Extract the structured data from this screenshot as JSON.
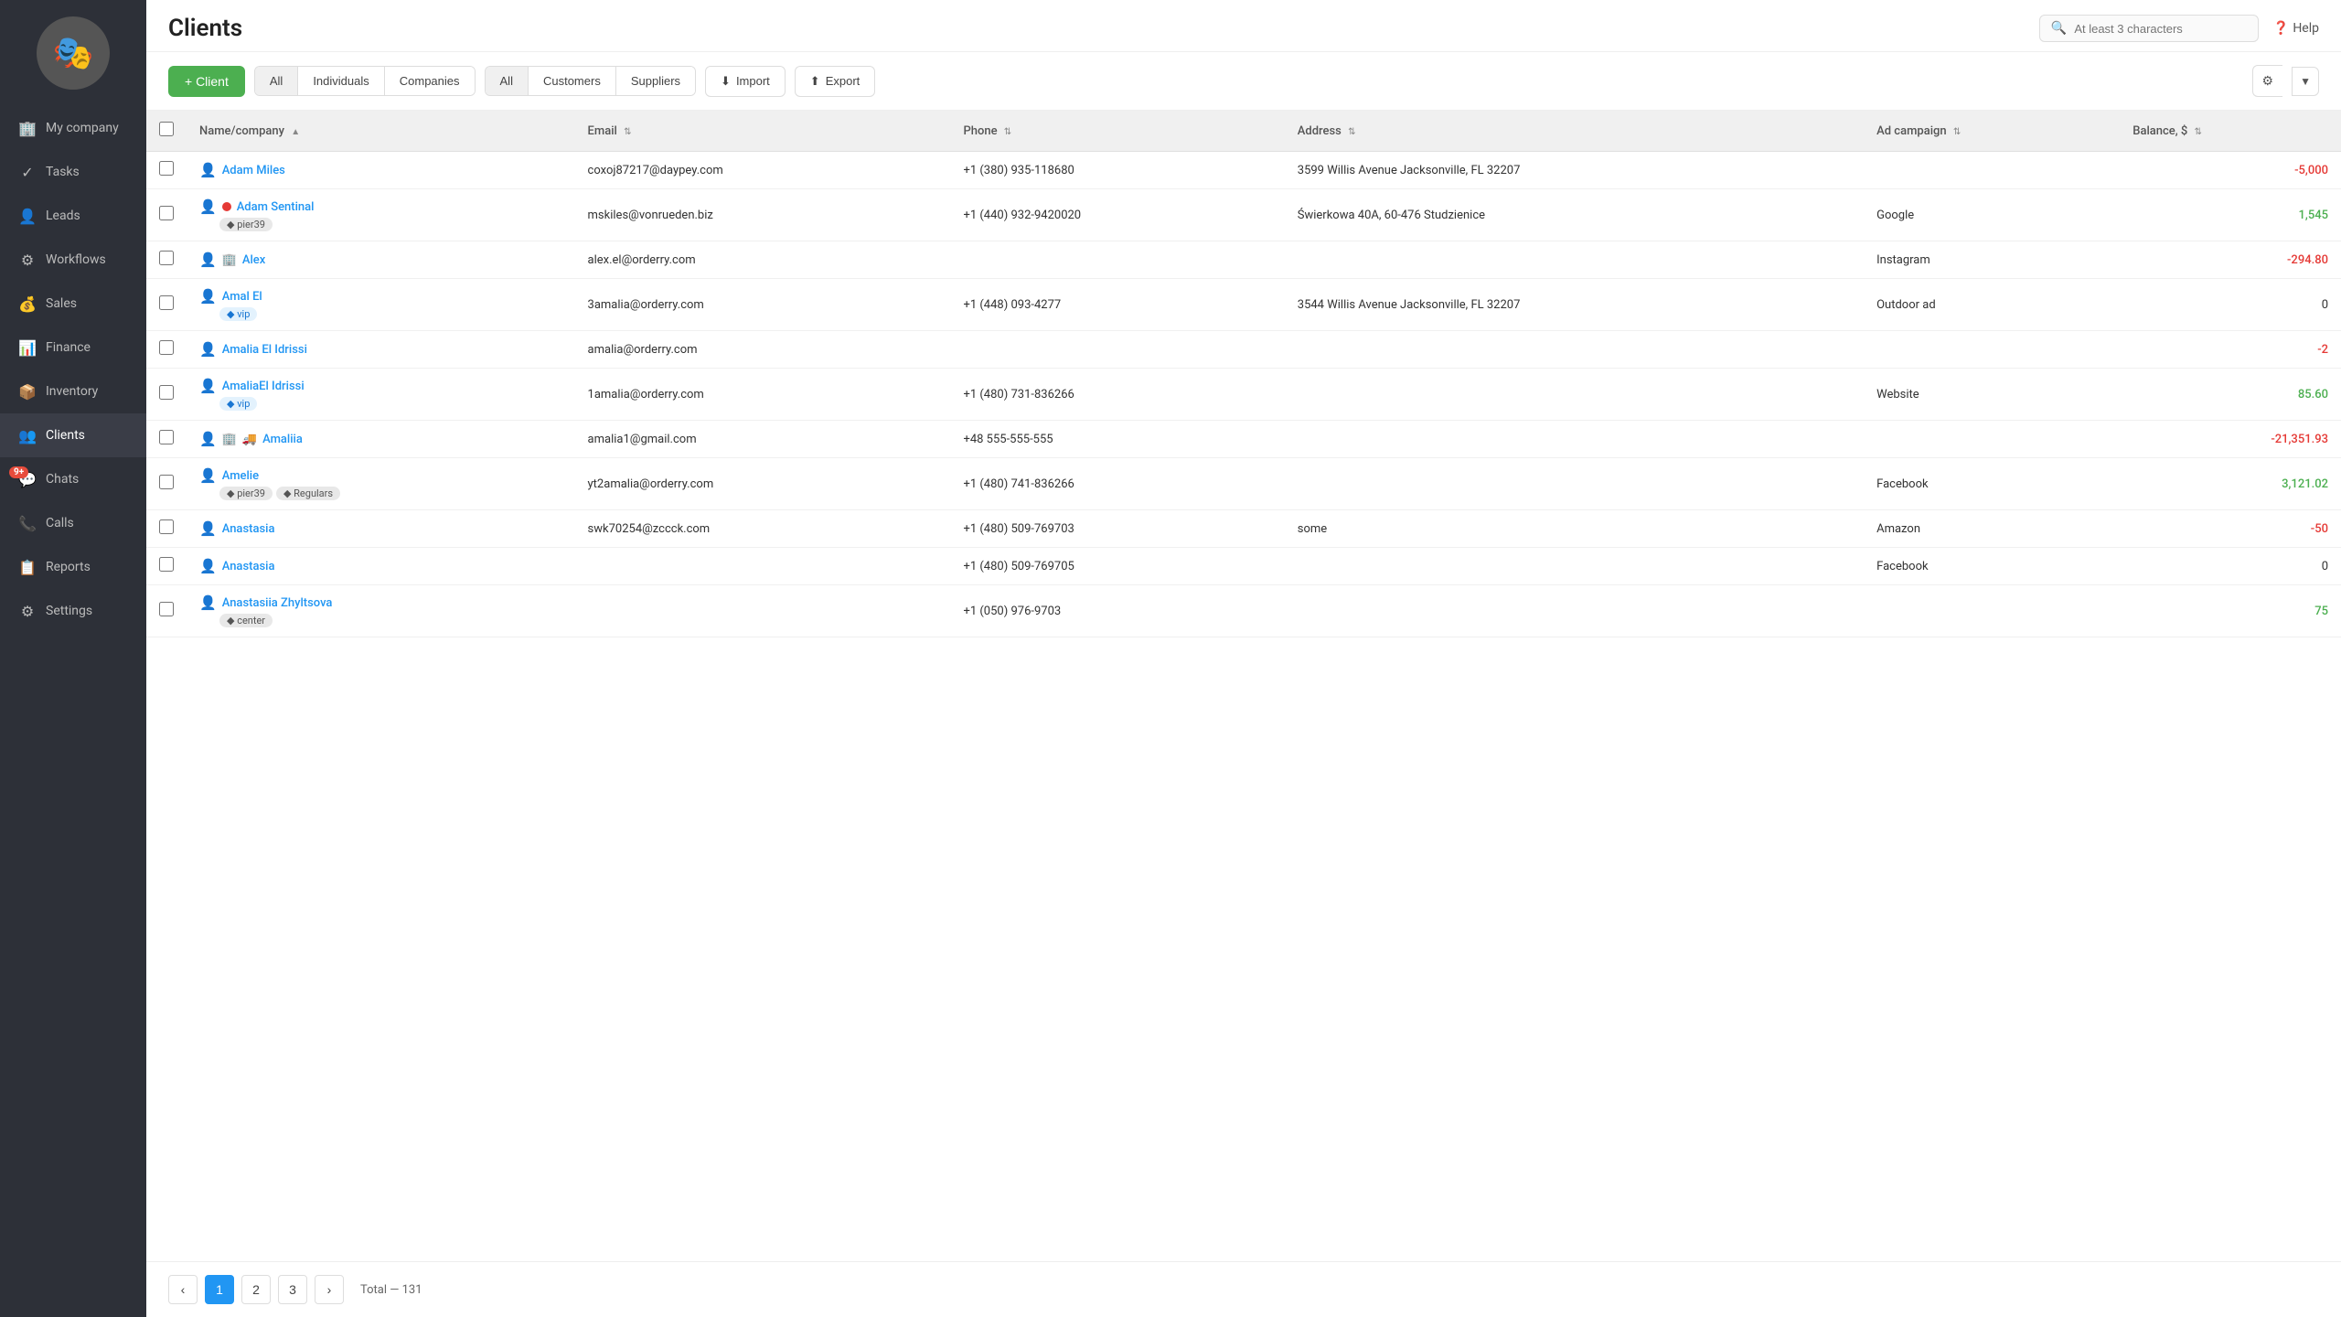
{
  "sidebar": {
    "avatar_emoji": "🎭",
    "items": [
      {
        "id": "my-company",
        "label": "My company",
        "icon": "🏢",
        "active": false
      },
      {
        "id": "tasks",
        "label": "Tasks",
        "icon": "✓",
        "active": false
      },
      {
        "id": "leads",
        "label": "Leads",
        "icon": "👤",
        "active": false
      },
      {
        "id": "workflows",
        "label": "Workflows",
        "icon": "⚙",
        "active": false
      },
      {
        "id": "sales",
        "label": "Sales",
        "icon": "💰",
        "active": false
      },
      {
        "id": "finance",
        "label": "Finance",
        "icon": "📊",
        "active": false
      },
      {
        "id": "inventory",
        "label": "Inventory",
        "icon": "📦",
        "active": false
      },
      {
        "id": "clients",
        "label": "Clients",
        "icon": "👥",
        "active": true
      },
      {
        "id": "chats",
        "label": "Chats",
        "icon": "💬",
        "active": false,
        "badge": "9+"
      },
      {
        "id": "calls",
        "label": "Calls",
        "icon": "📞",
        "active": false
      },
      {
        "id": "reports",
        "label": "Reports",
        "icon": "📋",
        "active": false
      },
      {
        "id": "settings",
        "label": "Settings",
        "icon": "⚙",
        "active": false
      }
    ]
  },
  "header": {
    "title": "Clients",
    "search_placeholder": "At least 3 characters",
    "help_label": "Help"
  },
  "toolbar": {
    "add_button": "+ Client",
    "filter_group1": [
      "All",
      "Individuals",
      "Companies"
    ],
    "filter_group2": [
      "All",
      "Customers",
      "Suppliers"
    ],
    "import_label": "Import",
    "export_label": "Export"
  },
  "table": {
    "columns": [
      {
        "id": "name",
        "label": "Name/company",
        "sortable": true
      },
      {
        "id": "email",
        "label": "Email",
        "sortable": true
      },
      {
        "id": "phone",
        "label": "Phone",
        "sortable": true
      },
      {
        "id": "address",
        "label": "Address",
        "sortable": true
      },
      {
        "id": "ad_campaign",
        "label": "Ad campaign",
        "sortable": true
      },
      {
        "id": "balance",
        "label": "Balance, $",
        "sortable": true
      }
    ],
    "rows": [
      {
        "name": "Adam Miles",
        "type": "individual",
        "tags": [],
        "email": "coxoj87217@daypey.com",
        "phone": "+1 (380) 935-118680",
        "address": "3599 Willis Avenue Jacksonville, FL 32207",
        "ad_campaign": "",
        "balance": "-5,000",
        "balance_type": "negative",
        "extra_icons": []
      },
      {
        "name": "Adam Sentinal",
        "type": "individual",
        "tags": [
          {
            "label": "pier39",
            "class": "tag-pier39"
          }
        ],
        "email": "mskiles@vonrueden.biz",
        "phone": "+1 (440) 932-9420020",
        "address": "Świerkowa 40A, 60-476 Studzienice",
        "ad_campaign": "Google",
        "balance": "1,545",
        "balance_type": "positive",
        "extra_icons": [
          "status-dot"
        ]
      },
      {
        "name": "Alex",
        "type": "individual",
        "tags": [],
        "email": "alex.el@orderry.com",
        "phone": "",
        "address": "",
        "ad_campaign": "Instagram",
        "balance": "-294.80",
        "balance_type": "negative",
        "extra_icons": [
          "company-icon"
        ]
      },
      {
        "name": "Amal El",
        "type": "individual",
        "tags": [
          {
            "label": "vip",
            "class": "tag-vip"
          }
        ],
        "email": "3amalia@orderry.com",
        "phone": "+1 (448) 093-4277",
        "address": "3544 Willis Avenue Jacksonville, FL 32207",
        "ad_campaign": "Outdoor ad",
        "balance": "0",
        "balance_type": "zero",
        "extra_icons": []
      },
      {
        "name": "Amalia El Idrissi",
        "type": "individual",
        "tags": [],
        "email": "amalia@orderry.com",
        "phone": "",
        "address": "",
        "ad_campaign": "",
        "balance": "-2",
        "balance_type": "negative",
        "extra_icons": []
      },
      {
        "name": "AmaliaEl Idrissi",
        "type": "individual",
        "tags": [
          {
            "label": "vip",
            "class": "tag-vip"
          }
        ],
        "email": "1amalia@orderry.com",
        "phone": "+1 (480) 731-836266",
        "address": "",
        "ad_campaign": "Website",
        "balance": "85.60",
        "balance_type": "positive",
        "extra_icons": []
      },
      {
        "name": "Amaliia",
        "type": "individual",
        "tags": [],
        "email": "amalia1@gmail.com",
        "phone": "+48 555-555-555",
        "address": "",
        "ad_campaign": "",
        "balance": "-21,351.93",
        "balance_type": "negative",
        "extra_icons": [
          "company-icon",
          "truck-icon"
        ]
      },
      {
        "name": "Amelie",
        "type": "individual",
        "tags": [
          {
            "label": "pier39",
            "class": "tag-pier39"
          },
          {
            "label": "Regulars",
            "class": "tag-regulars"
          }
        ],
        "email": "yt2amalia@orderry.com",
        "phone": "+1 (480) 741-836266",
        "address": "",
        "ad_campaign": "Facebook",
        "balance": "3,121.02",
        "balance_type": "positive",
        "extra_icons": []
      },
      {
        "name": "Anastasia",
        "type": "individual",
        "tags": [],
        "email": "swk70254@zccck.com",
        "phone": "+1 (480) 509-769703",
        "address": "some",
        "ad_campaign": "Amazon",
        "balance": "-50",
        "balance_type": "negative",
        "extra_icons": []
      },
      {
        "name": "Anastasia",
        "type": "individual",
        "tags": [],
        "email": "",
        "phone": "+1 (480) 509-769705",
        "address": "",
        "ad_campaign": "Facebook",
        "balance": "0",
        "balance_type": "zero",
        "extra_icons": []
      },
      {
        "name": "Anastasiia Zhyltsova",
        "type": "individual",
        "tags": [
          {
            "label": "center",
            "class": "tag-center"
          }
        ],
        "email": "",
        "phone": "+1 (050) 976-9703",
        "address": "",
        "ad_campaign": "",
        "balance": "75",
        "balance_type": "positive",
        "extra_icons": []
      }
    ]
  },
  "pagination": {
    "pages": [
      "1",
      "2",
      "3"
    ],
    "active_page": "1",
    "total_label": "Total — 131"
  }
}
